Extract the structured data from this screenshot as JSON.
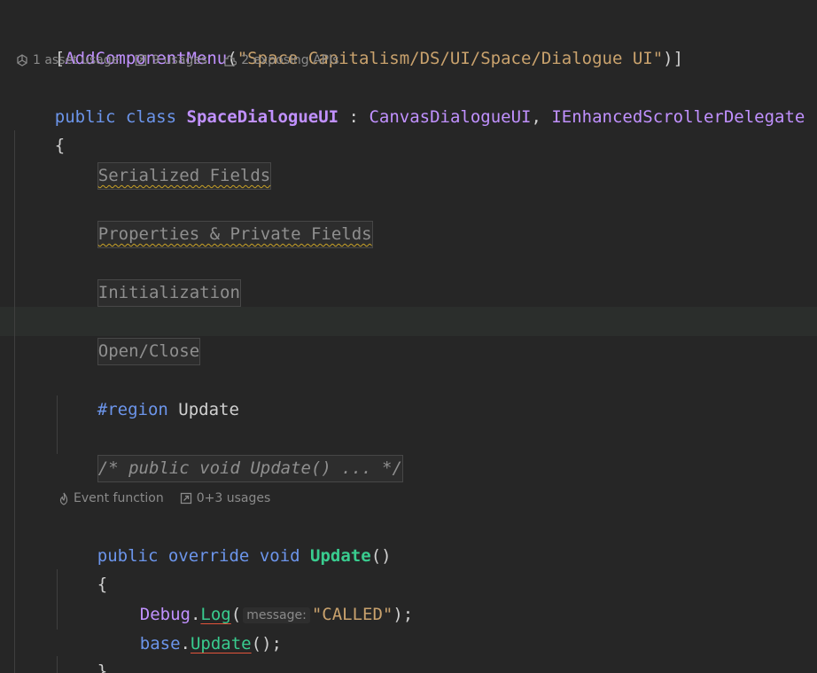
{
  "attribute": {
    "open": "[",
    "name": "AddComponentMenu",
    "paren_open": "(",
    "value": "\"Space Capitalism/DS/UI/Space/Dialogue UI\"",
    "close": ")]"
  },
  "class_hints": {
    "asset_usage": "1 asset usage",
    "usages": "9 usages",
    "exposing_apis": "2 exposing APIs"
  },
  "class_decl": {
    "kw_public": "public",
    "kw_class": "class",
    "name": "SpaceDialogueUI",
    "colon": " : ",
    "base": "CanvasDialogueUI",
    "comma": ", ",
    "interface": "IEnhancedScrollerDelegate"
  },
  "brace_open": "{",
  "brace_close": "}",
  "regions": {
    "serialized": "Serialized Fields",
    "properties": "Properties & Private Fields",
    "initialization": "Initialization",
    "open_close": "Open/Close"
  },
  "region_update": {
    "keyword": "#region",
    "name": "Update"
  },
  "folded_comment": "/* public void Update() ... */",
  "method_hints": {
    "event_function": "Event function",
    "usages": "0+3 usages"
  },
  "method_decl": {
    "kw_public": "public",
    "kw_override": "override",
    "kw_void": "void",
    "name": "Update",
    "parens": "()"
  },
  "body": {
    "debug_class": "Debug",
    "dot": ".",
    "log_method": "Log",
    "paren_open": "(",
    "param_hint": "message:",
    "log_arg": "\"CALLED\"",
    "log_end": ");",
    "base_kw": "base",
    "update_call": "Update",
    "update_end": "();"
  }
}
